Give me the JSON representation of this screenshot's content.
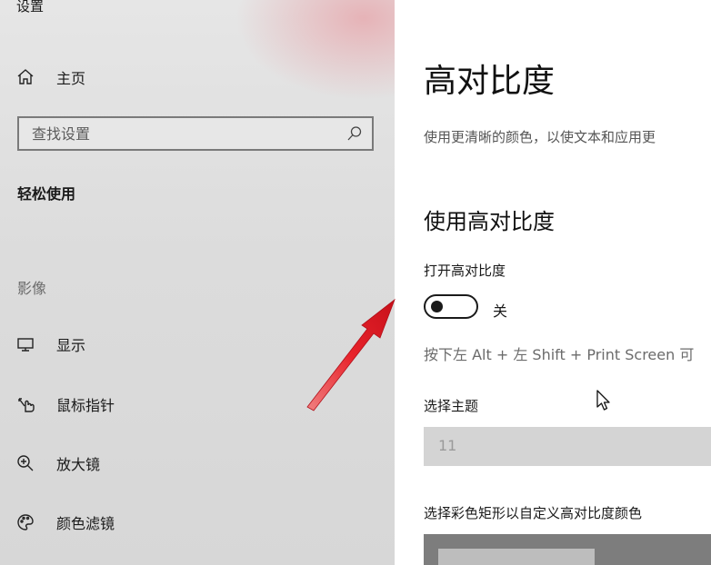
{
  "app": {
    "title": "设置"
  },
  "sidebar": {
    "home": {
      "label": "主页",
      "icon": "home-icon"
    },
    "search": {
      "placeholder": "查找设置",
      "icon": "search-icon"
    },
    "category": "轻松使用",
    "group_label": "影像",
    "items": [
      {
        "label": "显示",
        "icon": "monitor-icon"
      },
      {
        "label": "鼠标指针",
        "icon": "mouse-pointer-icon"
      },
      {
        "label": "放大镜",
        "icon": "magnifier-icon"
      },
      {
        "label": "颜色滤镜",
        "icon": "palette-icon"
      }
    ]
  },
  "main": {
    "title": "高对比度",
    "description": "使用更清晰的颜色，以使文本和应用更",
    "section_title": "使用高对比度",
    "toggle": {
      "label": "打开高对比度",
      "state": "关",
      "on": false
    },
    "shortcut_hint": "按下左 Alt + 左 Shift + Print Screen 可",
    "theme": {
      "label": "选择主题",
      "value": "11"
    },
    "color_label": "选择彩色矩形以自定义高对比度颜色"
  },
  "colors": {
    "arrow": "#e8232b",
    "sidebar_tint": "#e6aaaf"
  }
}
